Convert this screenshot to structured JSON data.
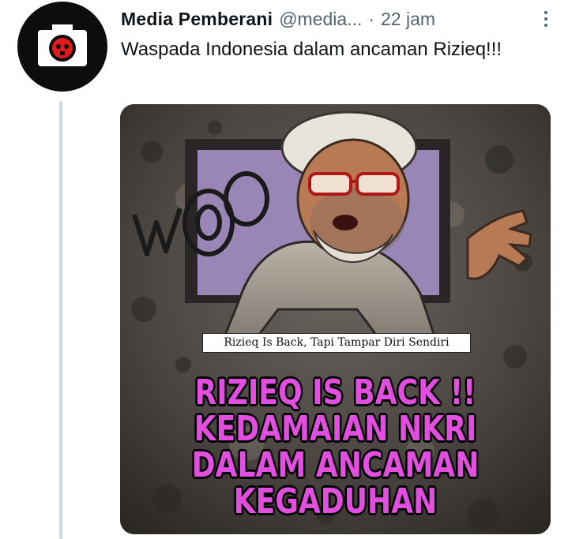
{
  "tweet": {
    "author_name": "Media Pemberani",
    "handle": "@media...",
    "separator": "·",
    "time": "22 jam",
    "text": "Waspada Indonesia dalam ancaman Rizieq!!!"
  },
  "media": {
    "caption": "Rizieq Is Back, Tapi Tampar Diri Sendiri",
    "graffiti": "WO",
    "headline_lines": [
      "RIZIEQ IS BACK !!",
      "KEDAMAIAN NKRI",
      "DALAM ANCAMAN",
      "KEGADUHAN"
    ]
  },
  "icons": {
    "avatar": "camera-skull-icon",
    "more": "more-vertical-icon"
  },
  "colors": {
    "headline": "#e24ee0",
    "thread_line": "#cfd9de",
    "secondary_text": "#536471"
  }
}
